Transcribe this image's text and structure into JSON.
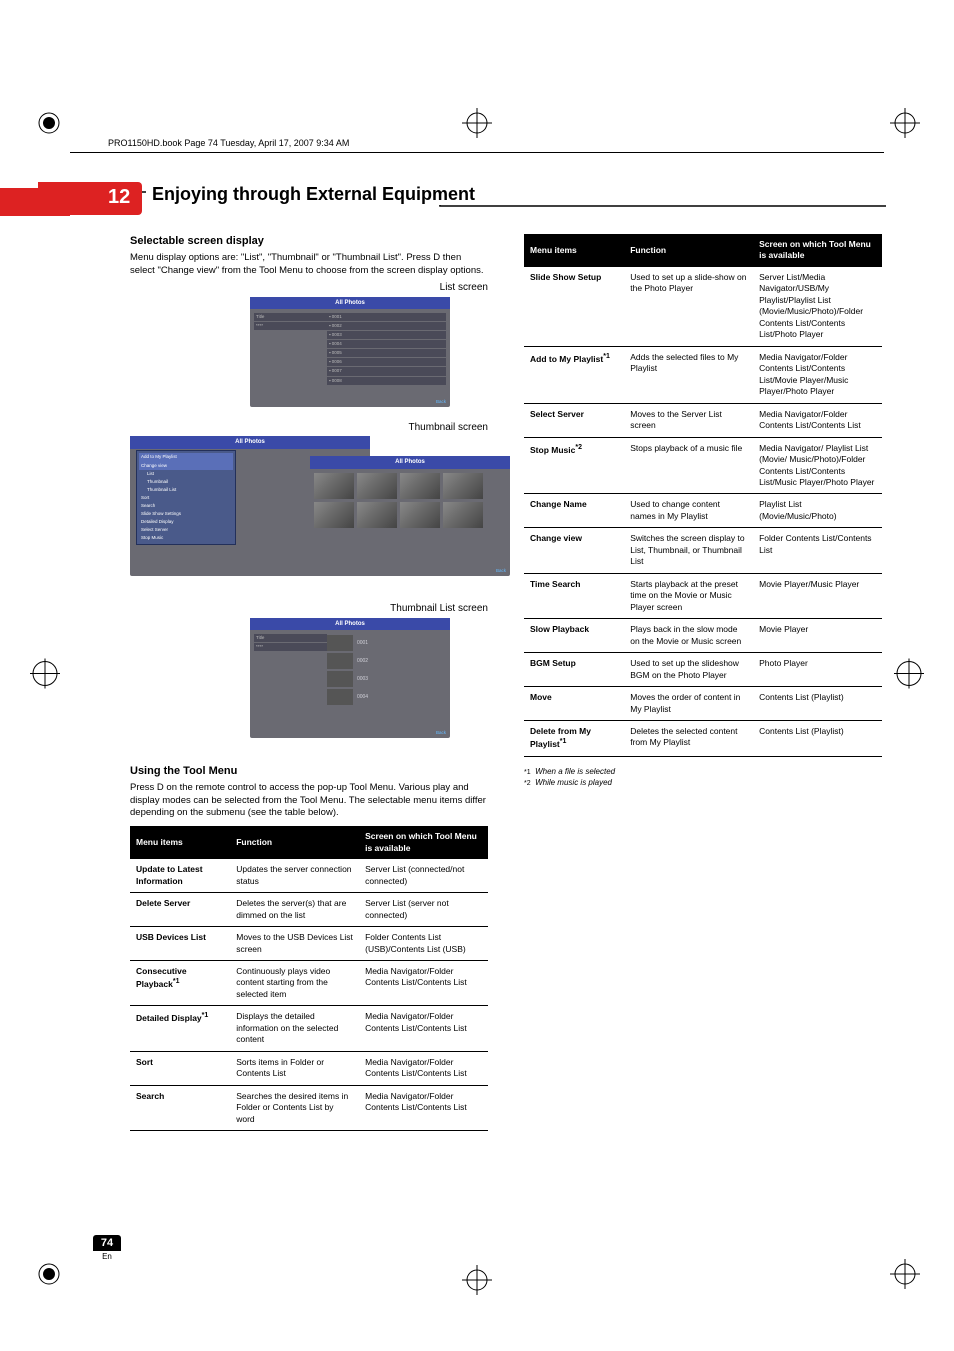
{
  "slug": "PRO1150HD.book  Page 74  Tuesday, April 17, 2007  9:34 AM",
  "chapter_number": "12",
  "chapter_title": "Enjoying through External Equipment",
  "left": {
    "h_selectable": "Selectable screen display",
    "p_selectable": "Menu display options are: \"List\", \"Thumbnail\" or \"Thumbnail List\". Press D then select \"Change view\" from the Tool Menu to choose from the screen display options.",
    "cap_list": "List screen",
    "cap_thumb": "Thumbnail screen",
    "cap_thumblist": "Thumbnail List screen",
    "h_tool": "Using the Tool Menu",
    "p_tool": "Press D on the remote control to access the pop-up Tool Menu. Various play and display modes can be selected from the Tool Menu. The selectable menu items differ depending on the submenu (see the table below).",
    "tv": {
      "title": "All Photos",
      "pop_items": [
        "Add to My Playlist",
        "Change view",
        "Sort",
        "Search",
        "Slide Show Settings",
        "Detailed Display",
        "Select Server",
        "Stop Music"
      ],
      "pop_sub": [
        "List",
        "Thumbnail",
        "Thumbnail List"
      ],
      "back": "Back"
    }
  },
  "table_headers": {
    "c1": "Menu items",
    "c2": "Function",
    "c3": "Screen on which Tool Menu is available"
  },
  "table_left": [
    {
      "item": "Update to Latest Information",
      "func": "Updates the server connection status",
      "avail": "Server List (connected/not connected)"
    },
    {
      "item": "Delete Server",
      "func": "Deletes the server(s) that are dimmed on the list",
      "avail": "Server List (server not connected)"
    },
    {
      "item": "USB Devices List",
      "func": "Moves to the USB Devices List screen",
      "avail": "Folder Contents List (USB)/Contents List (USB)"
    },
    {
      "item": "Consecutive Playback*1",
      "func": "Continuously plays video content starting from the selected item",
      "avail": "Media Navigator/Folder Contents List/Contents List"
    },
    {
      "item": "Detailed Display*1",
      "func": "Displays the detailed information on the selected content",
      "avail": "Media Navigator/Folder Contents List/Contents List"
    },
    {
      "item": "Sort",
      "func": "Sorts items in Folder or Contents List",
      "avail": "Media Navigator/Folder Contents List/Contents List"
    },
    {
      "item": "Search",
      "func": "Searches the desired items in Folder or Contents List by word",
      "avail": "Media Navigator/Folder Contents List/Contents List"
    }
  ],
  "table_right": [
    {
      "item": "Slide Show Setup",
      "func": "Used to set up a slide-show on the Photo Player",
      "avail": "Server List/Media Navigator/USB/My Playlist/Playlist List (Movie/Music/Photo)/Folder Contents List/Contents List/Photo Player"
    },
    {
      "item": "Add to My Playlist*1",
      "func": "Adds the selected files to My Playlist",
      "avail": "Media Navigator/Folder Contents List/Contents List/Movie Player/Music Player/Photo Player"
    },
    {
      "item": "Select Server",
      "func": "Moves to the Server List screen",
      "avail": "Media Navigator/Folder Contents List/Contents List"
    },
    {
      "item": "Stop Music*2",
      "func": "Stops playback of a music file",
      "avail": "Media Navigator/ Playlist List (Movie/ Music/Photo)/Folder Contents List/Contents List/Music Player/Photo Player"
    },
    {
      "item": "Change Name",
      "func": "Used to change content names in My Playlist",
      "avail": "Playlist List (Movie/Music/Photo)"
    },
    {
      "item": "Change view",
      "func": "Switches the screen display to List, Thumbnail, or Thumbnail List",
      "avail": "Folder Contents List/Contents List"
    },
    {
      "item": "Time Search",
      "func": "Starts playback at the preset time on the Movie or Music Player screen",
      "avail": "Movie Player/Music Player"
    },
    {
      "item": "Slow Playback",
      "func": "Plays back in the slow mode on the Movie or Music screen",
      "avail": "Movie Player"
    },
    {
      "item": "BGM Setup",
      "func": "Used to set up the slideshow BGM on the Photo Player",
      "avail": "Photo Player"
    },
    {
      "item": "Move",
      "func": "Moves the order of content in My Playlist",
      "avail": "Contents List (Playlist)"
    },
    {
      "item": "Delete from My Playlist*1",
      "func": "Deletes the selected content from My Playlist",
      "avail": "Contents List (Playlist)"
    }
  ],
  "footnotes": {
    "f1_num": "*1",
    "f1_text": "When a file is selected",
    "f2_num": "*2",
    "f2_text": "While music is played"
  },
  "page_number": "74",
  "page_lang": "En"
}
